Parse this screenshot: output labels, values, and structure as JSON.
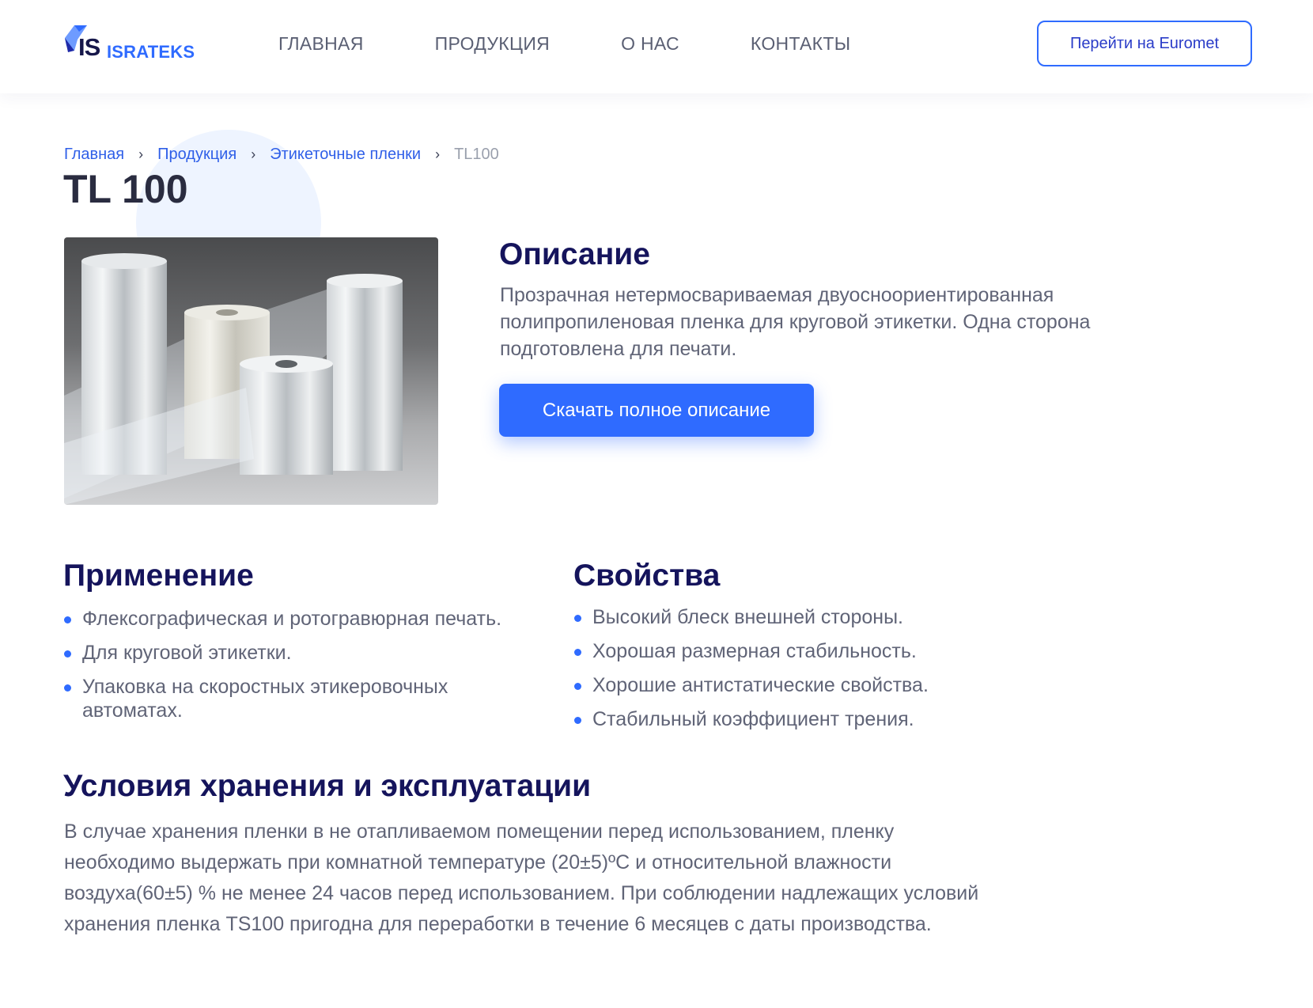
{
  "header": {
    "logo_mark": "IS",
    "logo_text": "ISRATEKS",
    "nav": [
      "ГЛАВНАЯ",
      "ПРОДУКЦИЯ",
      "О НАС",
      "КОНТАКТЫ"
    ],
    "euromet_button": "Перейти на Euromet"
  },
  "breadcrumb": {
    "items": [
      "Главная",
      "Продукция",
      "Этикеточные пленки"
    ],
    "current": "TL100",
    "separator": "›"
  },
  "page_title": "TL 100",
  "description": {
    "title": "Описание",
    "text": "Прозрачная нетермосвариваемая двуосноориентированная полипропиленовая пленка для круговой этикетки. Одна сторона подготовлена для печати.",
    "download_button": "Скачать полное описание"
  },
  "application": {
    "title": "Применение",
    "items": [
      "Флексографическая и ротогравюрная печать.",
      "Для круговой этикетки.",
      "Упаковка на скоростных этикеровочных автоматах."
    ]
  },
  "properties": {
    "title": "Свойства",
    "items": [
      "Высокий блеск внешней стороны.",
      "Хорошая размерная стабильность.",
      "Хорошие антистатические свойства.",
      "Стабильный коэффициент трения."
    ]
  },
  "storage": {
    "title": "Условия хранения и эксплуатации",
    "text": "В случае хранения пленки в не отапливаемом помещении перед использованием, пленку необходимо выдержать при комнатной температуре (20±5)ºC и относительной влажности воздуха(60±5) % не менее 24 часов перед использованием. При соблюдении надлежащих условий хранения пленка TS100 пригодна для переработки в течение 6 месяцев с даты производства."
  },
  "colors": {
    "accent": "#2f6bff",
    "heading": "#15145c",
    "body_text": "#606477"
  }
}
